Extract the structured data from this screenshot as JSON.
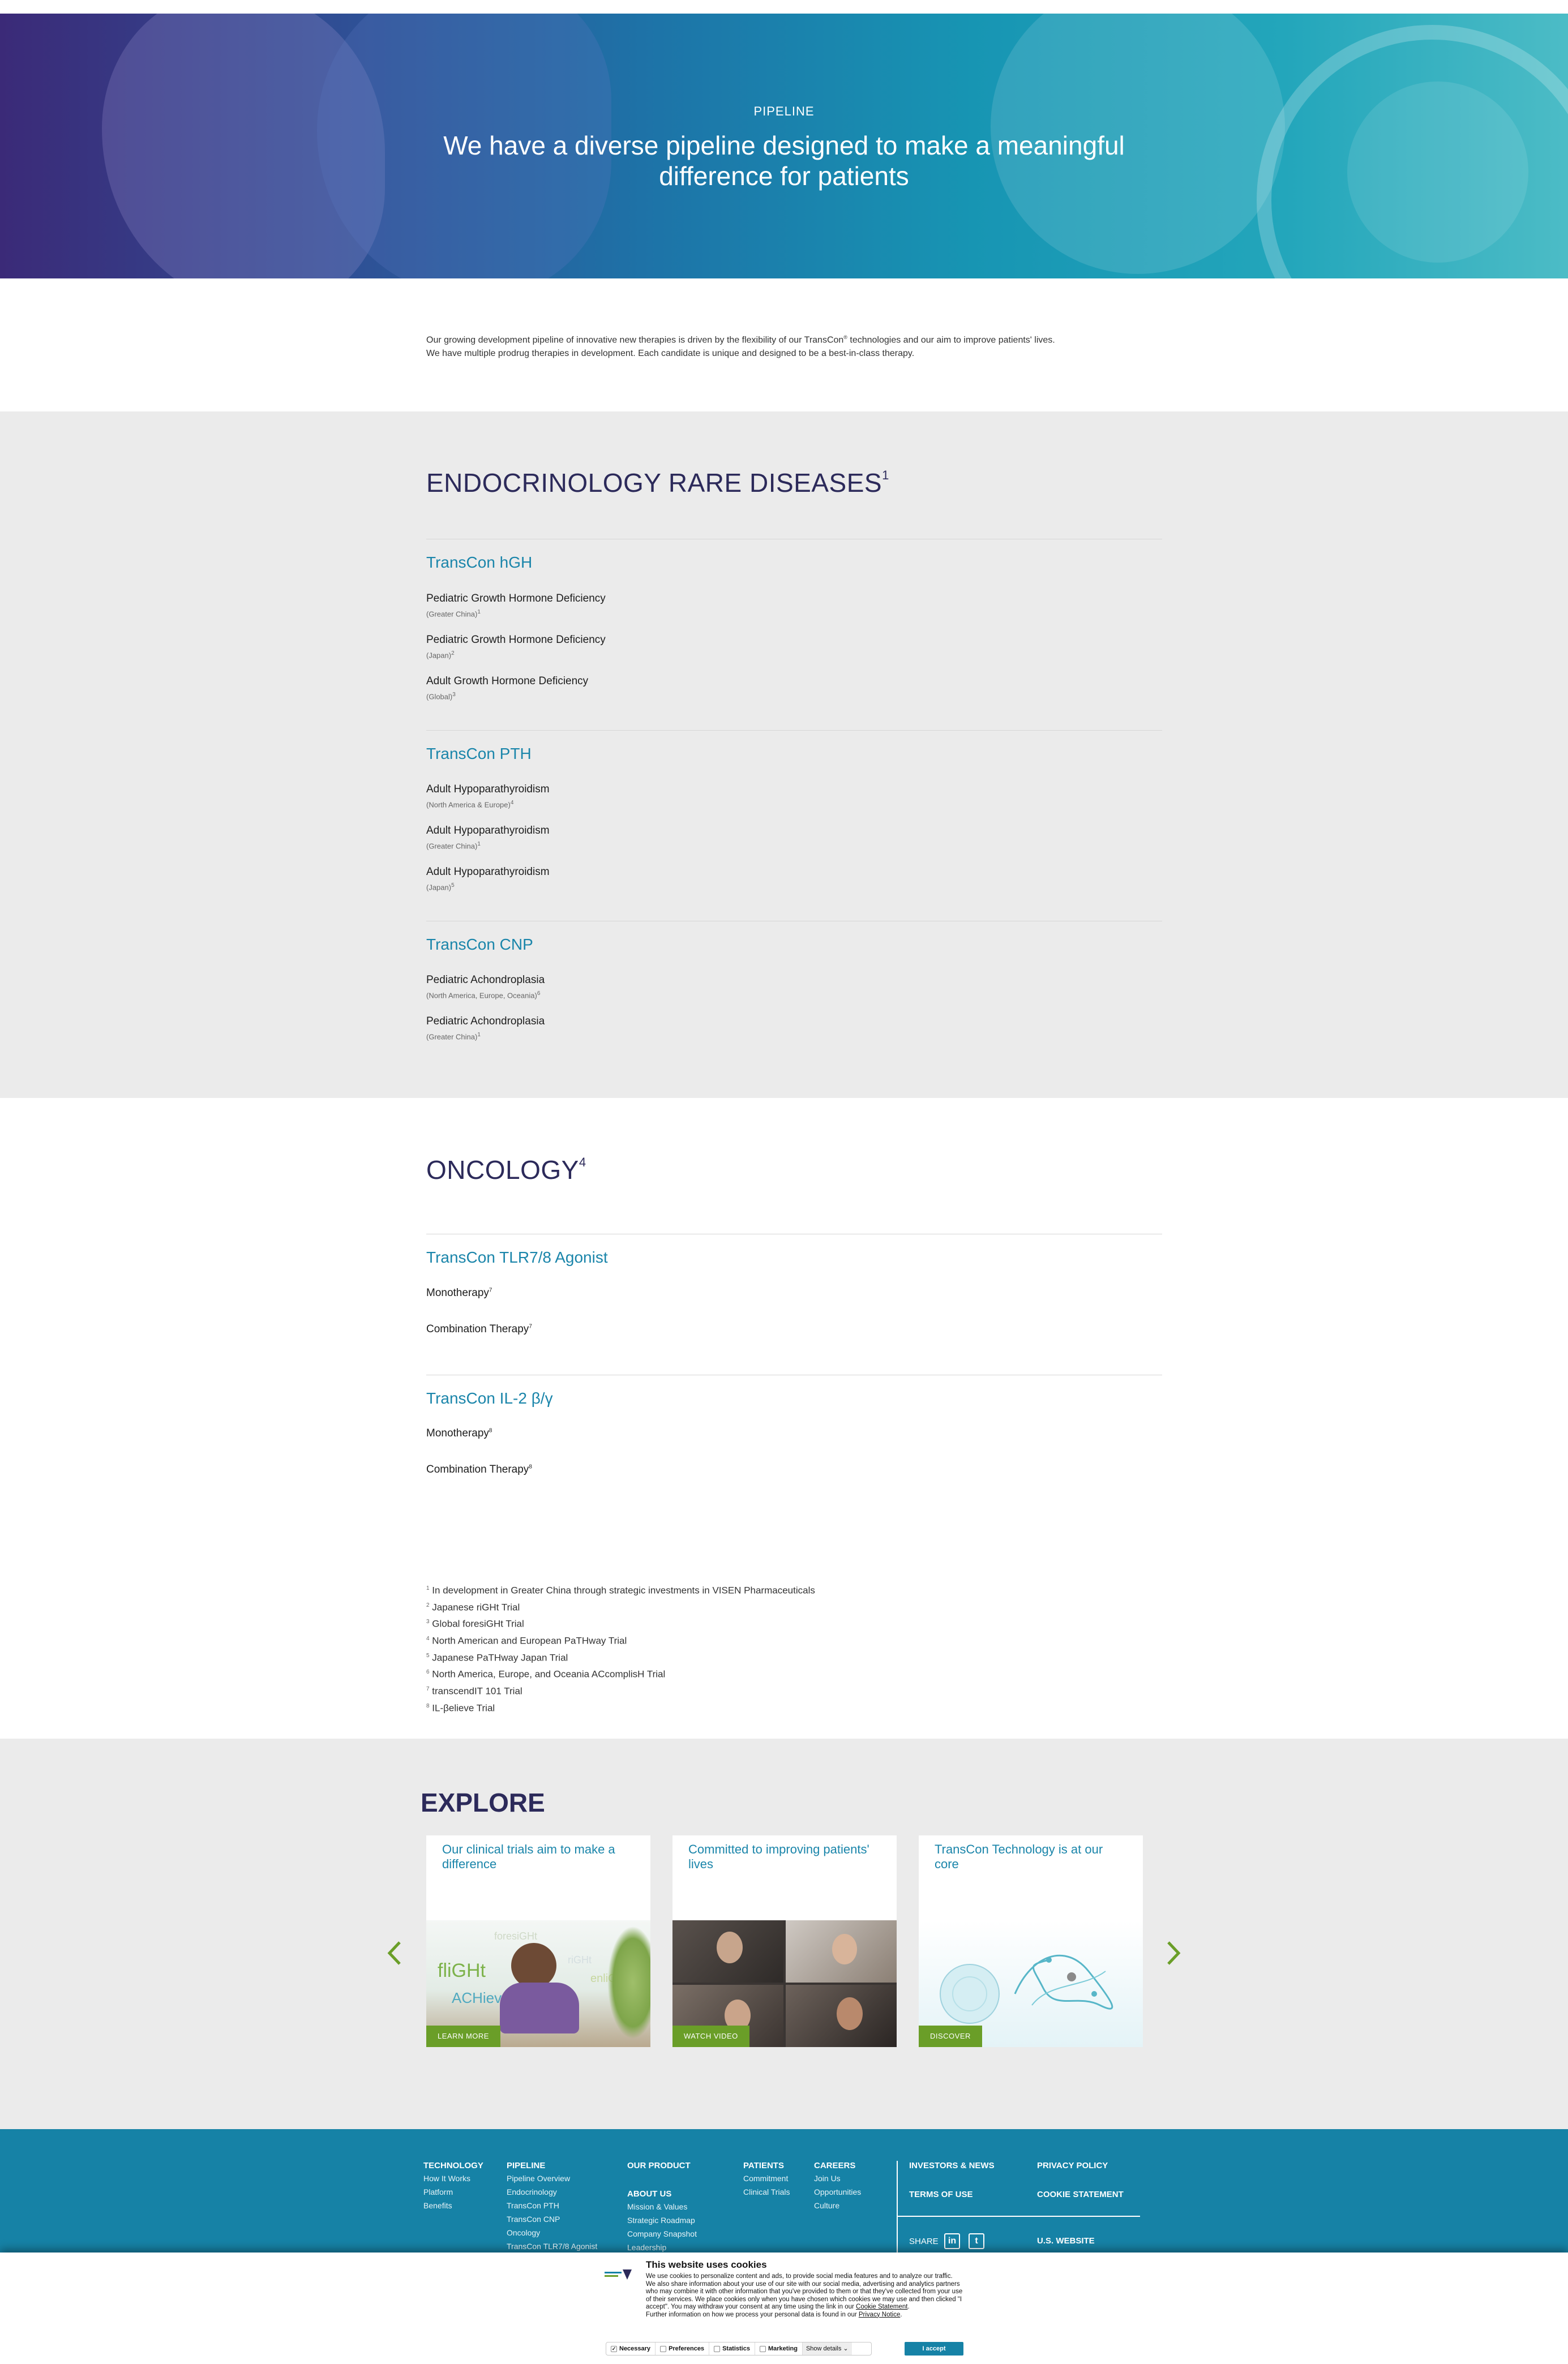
{
  "hero": {
    "eyebrow": "PIPELINE",
    "title": "We have a diverse pipeline designed to make a meaningful difference for patients"
  },
  "intro": {
    "line1_pre": "Our growing development pipeline of innovative new therapies is driven by the flexibility of our TransCon",
    "line1_post": " technologies and our aim to improve patients' lives.",
    "line2": "We have multiple prodrug therapies in development. Each candidate is unique and designed to be a best-in-class therapy."
  },
  "endocrinology": {
    "heading": "ENDOCRINOLOGY RARE DISEASES",
    "heading_sup": "1",
    "products": [
      {
        "name": "TransCon hGH",
        "indications": [
          {
            "label": "Pediatric Growth Hormone Deficiency",
            "region": "(Greater China)",
            "sup": "1"
          },
          {
            "label": "Pediatric Growth Hormone Deficiency",
            "region": "(Japan)",
            "sup": "2"
          },
          {
            "label": "Adult Growth Hormone Deficiency",
            "region": "(Global)",
            "sup": "3"
          }
        ]
      },
      {
        "name": "TransCon PTH",
        "indications": [
          {
            "label": "Adult Hypoparathyroidism",
            "region": "(North America & Europe)",
            "sup": "4"
          },
          {
            "label": "Adult Hypoparathyroidism",
            "region": "(Greater China)",
            "sup": "1"
          },
          {
            "label": "Adult Hypoparathyroidism",
            "region": "(Japan)",
            "sup": "5"
          }
        ]
      },
      {
        "name": "TransCon CNP",
        "indications": [
          {
            "label": "Pediatric Achondroplasia",
            "region": "(North America, Europe, Oceania)",
            "sup": "6"
          },
          {
            "label": "Pediatric Achondroplasia",
            "region": "(Greater China)",
            "sup": "1"
          }
        ]
      }
    ]
  },
  "oncology": {
    "heading": "ONCOLOGY",
    "heading_sup": "4",
    "products": [
      {
        "name": "TransCon TLR7/8 Agonist",
        "indications": [
          {
            "label": "Monotherapy",
            "sup": "7"
          },
          {
            "label": "Combination Therapy",
            "sup": "7"
          }
        ]
      },
      {
        "name": "TransCon IL-2 β/γ",
        "indications": [
          {
            "label": "Monotherapy",
            "sup": "8"
          },
          {
            "label": "Combination Therapy",
            "sup": "8"
          }
        ]
      }
    ]
  },
  "footnotes": [
    {
      "num": "1",
      "text": "In development in Greater China through strategic investments in VISEN Pharmaceuticals"
    },
    {
      "num": "2",
      "text": "Japanese riGHt Trial"
    },
    {
      "num": "3",
      "text": "Global foresiGHt Trial"
    },
    {
      "num": "4",
      "text": "North American and European PaTHway Trial"
    },
    {
      "num": "5",
      "text": "Japanese PaTHway Japan Trial"
    },
    {
      "num": "6",
      "text": "North America, Europe, and Oceania ACcomplisH Trial"
    },
    {
      "num": "7",
      "text": "transcendIT 101 Trial"
    },
    {
      "num": "8",
      "text": "IL-βelieve Trial"
    }
  ],
  "explore": {
    "heading": "EXPLORE",
    "cards": [
      {
        "title": "Our clinical trials aim to make a difference",
        "button": "LEARN MORE",
        "img_words": [
          "fliGHt",
          "ACHieve",
          "foresiGHt",
          "enliGHten",
          "riGHt"
        ]
      },
      {
        "title": "Committed to improving patients' lives",
        "button": "WATCH VIDEO"
      },
      {
        "title": "TransCon Technology is at our core",
        "button": "DISCOVER"
      }
    ],
    "prev_icon": "chevron-left-icon",
    "next_icon": "chevron-right-icon"
  },
  "footer": {
    "columns": [
      {
        "heading": "TECHNOLOGY",
        "links": [
          "How It Works",
          "Platform",
          "Benefits"
        ]
      },
      {
        "heading": "PIPELINE",
        "links": [
          "Pipeline Overview",
          "Endocrinology",
          "TransCon PTH",
          "TransCon CNP",
          "Oncology",
          "TransCon TLR7/8 Agonist"
        ]
      },
      {
        "heading": "OUR PRODUCT",
        "links": []
      },
      {
        "heading": "ABOUT US",
        "links": [
          "Mission & Values",
          "Strategic Roadmap",
          "Company Snapshot",
          "Leadership"
        ]
      },
      {
        "heading": "PATIENTS",
        "links": [
          "Commitment",
          "Clinical Trials"
        ]
      },
      {
        "heading": "CAREERS",
        "links": [
          "Join Us",
          "Opportunities",
          "Culture"
        ]
      }
    ],
    "right_links": [
      "INVESTORS & NEWS",
      "PRIVACY POLICY",
      "TERMS OF USE",
      "COOKIE STATEMENT",
      "U.S. WEBSITE"
    ],
    "share_label": "SHARE",
    "share_icons": [
      "linkedin-icon",
      "twitter-icon"
    ],
    "linkedin_glyph": "in",
    "twitter_glyph": "t"
  },
  "cookie": {
    "title": "This website uses cookies",
    "body1": "We use cookies to personalize content and ads, to provide social media features and to analyze our traffic. We also share information about your use of our site with our social media, advertising and analytics partners who may combine it with other information that you've provided to them or that they've collected from your use of their services. We place cookies only when you have chosen which cookies we may use and then clicked \"I accept\". You may withdraw your consent at any time using the link in our ",
    "body_link1": "Cookie Statement",
    "body2": ".",
    "body3": "Further information on how we process your personal data is found in our ",
    "body_link2": "Privacy Notice",
    "body4": ".",
    "options": [
      "Necessary",
      "Preferences",
      "Statistics",
      "Marketing"
    ],
    "show_details": "Show details",
    "accept": "I accept",
    "colors": {
      "accent": "#1682a6",
      "button_green": "#6a9e28",
      "heading": "#2c2a5a"
    }
  }
}
